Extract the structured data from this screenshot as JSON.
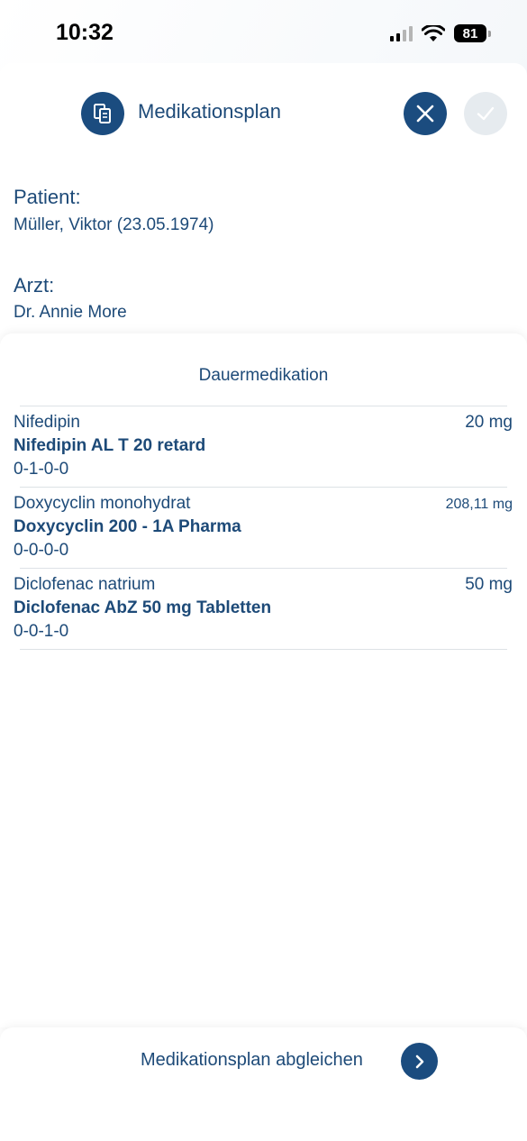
{
  "status_bar": {
    "time": "10:32",
    "battery_level": "81",
    "icons": [
      "cellular-signal-icon",
      "wifi-icon",
      "battery-icon"
    ]
  },
  "header": {
    "title": "Medikationsplan",
    "icons": [
      "document-copy-icon",
      "close-icon",
      "checkmark-icon"
    ]
  },
  "patient": {
    "label": "Patient:",
    "value": "Müller, Viktor  (23.05.1974)"
  },
  "doctor": {
    "label": "Arzt:",
    "value": "Dr. Annie More"
  },
  "medication": {
    "section_title": "Dauermedikation",
    "items": [
      {
        "substance": "Nifedipin",
        "name": "Nifedipin AL T 20 retard",
        "dosage": "0-1-0-0",
        "strength": "20 mg"
      },
      {
        "substance": "Doxycyclin monohydrat",
        "name": "Doxycyclin 200 - 1A Pharma",
        "dosage": "0-0-0-0",
        "strength": "208,11 mg"
      },
      {
        "substance": "Diclofenac natrium",
        "name": "Diclofenac AbZ 50 mg Tabletten",
        "dosage": "0-0-1-0",
        "strength": "50 mg"
      }
    ]
  },
  "footer": {
    "action_label": "Medikationsplan abgleichen",
    "icon": "chevron-right-icon"
  },
  "colors": {
    "primary": "#1b4c7f",
    "text": "#1d4a78",
    "disabled": "#e6ebef"
  }
}
